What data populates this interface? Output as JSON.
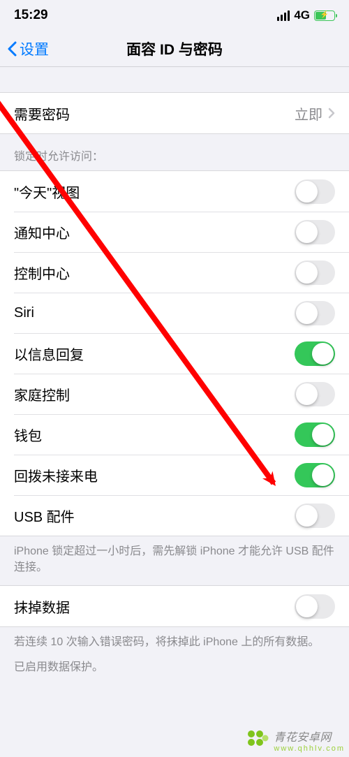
{
  "status": {
    "time": "15:29",
    "network": "4G"
  },
  "nav": {
    "back": "设置",
    "title": "面容 ID 与密码"
  },
  "require_passcode": {
    "label": "需要密码",
    "value": "立即"
  },
  "lock_access": {
    "header": "锁定时允许访问：",
    "items": [
      {
        "label": "\"今天\"视图",
        "on": false
      },
      {
        "label": "通知中心",
        "on": false
      },
      {
        "label": "控制中心",
        "on": false
      },
      {
        "label": "Siri",
        "on": false
      },
      {
        "label": "以信息回复",
        "on": true
      },
      {
        "label": "家庭控制",
        "on": false
      },
      {
        "label": "钱包",
        "on": true
      },
      {
        "label": "回拨未接来电",
        "on": true
      },
      {
        "label": "USB 配件",
        "on": false
      }
    ],
    "footer": "iPhone 锁定超过一小时后，需先解锁 iPhone 才能允许 USB 配件连接。"
  },
  "erase": {
    "label": "抹掉数据",
    "on": false,
    "footer1": "若连续 10 次输入错误密码，将抹掉此 iPhone 上的所有数据。",
    "footer2": "已启用数据保护。"
  },
  "watermark": {
    "text": "青花安卓网",
    "url": "www.qhhlv.com"
  }
}
